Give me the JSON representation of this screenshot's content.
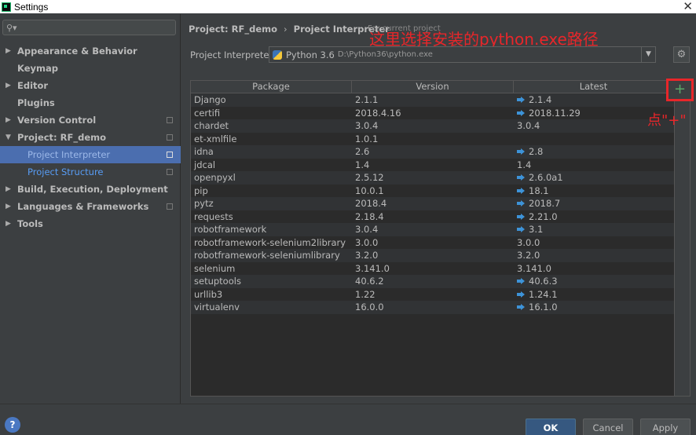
{
  "window": {
    "title": "Settings"
  },
  "sidebar": {
    "search_placeholder": "",
    "items": [
      {
        "label": "Appearance & Behavior",
        "arrow": "▶",
        "copy": false
      },
      {
        "label": "Keymap",
        "arrow": "",
        "copy": false
      },
      {
        "label": "Editor",
        "arrow": "▶",
        "copy": false
      },
      {
        "label": "Plugins",
        "arrow": "",
        "copy": false
      },
      {
        "label": "Version Control",
        "arrow": "▶",
        "copy": true
      },
      {
        "label": "Project: RF_demo",
        "arrow": "▼",
        "copy": true
      },
      {
        "label": "Project Interpreter",
        "arrow": "",
        "copy": true,
        "selected": true,
        "child": true
      },
      {
        "label": "Project Structure",
        "arrow": "",
        "copy": true,
        "child": true
      },
      {
        "label": "Build, Execution, Deployment",
        "arrow": "▶",
        "copy": false
      },
      {
        "label": "Languages & Frameworks",
        "arrow": "▶",
        "copy": true
      },
      {
        "label": "Tools",
        "arrow": "▶",
        "copy": false
      }
    ]
  },
  "breadcrumb": {
    "project": "Project: RF_demo",
    "page": "Project Interpreter",
    "separator": "›",
    "note": "For current project"
  },
  "annotations": {
    "top": "这里选择安装的python.exe路径",
    "plus": "点\"+\""
  },
  "interpreter": {
    "label": "Project Interpreter:",
    "name": "Python 3.6",
    "path": "D:\\Python36\\python.exe"
  },
  "table": {
    "headers": [
      "Package",
      "Version",
      "Latest"
    ],
    "rows": [
      {
        "package": "Django",
        "version": "2.1.1",
        "latest": "2.1.4",
        "upgrade": true
      },
      {
        "package": "certifi",
        "version": "2018.4.16",
        "latest": "2018.11.29",
        "upgrade": true
      },
      {
        "package": "chardet",
        "version": "3.0.4",
        "latest": "3.0.4",
        "upgrade": false
      },
      {
        "package": "et-xmlfile",
        "version": "1.0.1",
        "latest": "",
        "upgrade": false
      },
      {
        "package": "idna",
        "version": "2.6",
        "latest": "2.8",
        "upgrade": true
      },
      {
        "package": "jdcal",
        "version": "1.4",
        "latest": "1.4",
        "upgrade": false
      },
      {
        "package": "openpyxl",
        "version": "2.5.12",
        "latest": "2.6.0a1",
        "upgrade": true
      },
      {
        "package": "pip",
        "version": "10.0.1",
        "latest": "18.1",
        "upgrade": true
      },
      {
        "package": "pytz",
        "version": "2018.4",
        "latest": "2018.7",
        "upgrade": true
      },
      {
        "package": "requests",
        "version": "2.18.4",
        "latest": "2.21.0",
        "upgrade": true
      },
      {
        "package": "robotframework",
        "version": "3.0.4",
        "latest": "3.1",
        "upgrade": true
      },
      {
        "package": "robotframework-selenium2library",
        "version": "3.0.0",
        "latest": "3.0.0",
        "upgrade": false
      },
      {
        "package": "robotframework-seleniumlibrary",
        "version": "3.2.0",
        "latest": "3.2.0",
        "upgrade": false
      },
      {
        "package": "selenium",
        "version": "3.141.0",
        "latest": "3.141.0",
        "upgrade": false
      },
      {
        "package": "setuptools",
        "version": "40.6.2",
        "latest": "40.6.3",
        "upgrade": true
      },
      {
        "package": "urllib3",
        "version": "1.22",
        "latest": "1.24.1",
        "upgrade": true
      },
      {
        "package": "virtualenv",
        "version": "16.0.0",
        "latest": "16.1.0",
        "upgrade": true
      }
    ]
  },
  "buttons": {
    "ok": "OK",
    "cancel": "Cancel",
    "apply": "Apply",
    "help": "?",
    "add": "+"
  },
  "colors": {
    "accent": "#4b6eaf",
    "annotation": "#e8262a",
    "upgrade_arrow": "#3d93d8"
  }
}
